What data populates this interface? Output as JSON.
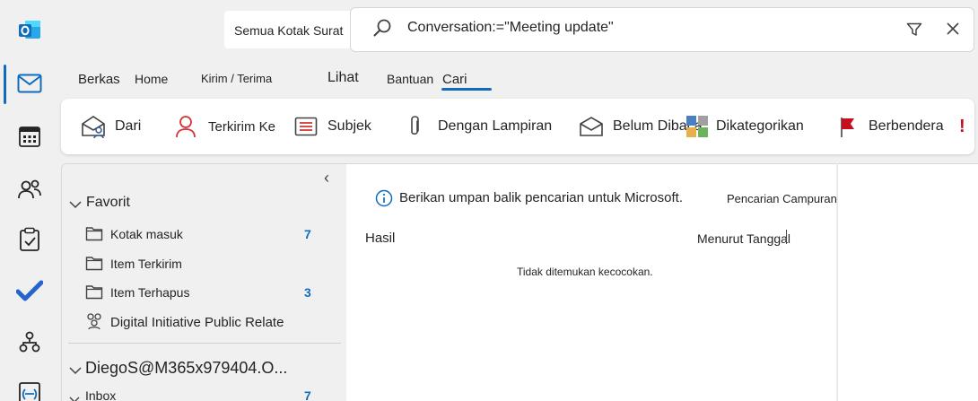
{
  "search": {
    "scope": "Semua Kotak Surat",
    "query": "Conversation:=\"Meeting update\""
  },
  "tabs": [
    "Berkas",
    "Home",
    "Kirim / Terima",
    "Lihat",
    "Bantuan",
    "Cari"
  ],
  "ribbon": {
    "from": "Dari",
    "sent_to": "Terkirim Ke",
    "subject": "Subjek",
    "with_attachment": "Dengan Lampiran",
    "unread": "Belum Dibaca",
    "categorized": "Dikategorikan",
    "flagged": "Berbendera",
    "important": "!"
  },
  "folders": {
    "favorites_label": "Favorit",
    "items": [
      {
        "label": "Kotak masuk",
        "count": "7"
      },
      {
        "label": "Item Terkirim",
        "count": ""
      },
      {
        "label": "Item Terhapus",
        "count": "3"
      },
      {
        "label": "Digital Initiative Public Relate",
        "count": ""
      }
    ],
    "account": "DiegoS@M365x979404.O...",
    "inbox_label": "Inbox",
    "inbox_count": "7",
    "collapse_glyph": "‹"
  },
  "messages": {
    "feedback": "Berikan umpan balik pencarian untuk Microsoft.",
    "mixed_search": "Pencarian Campuran",
    "results_label": "Hasil",
    "sort_label": "Menurut Tanggal",
    "empty_text": "Tidak ditemukan kecocokan."
  },
  "colors": {
    "accent": "#0f6cbd",
    "flag_red": "#c50f1f",
    "person_red": "#d13438"
  }
}
